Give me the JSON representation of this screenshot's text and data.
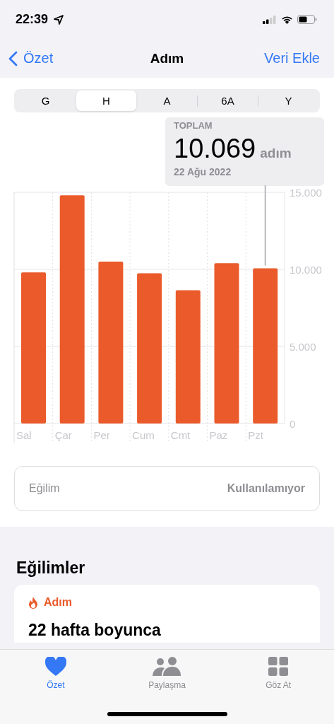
{
  "status_bar": {
    "time": "22:39"
  },
  "nav": {
    "back": "Özet",
    "title": "Adım",
    "action": "Veri Ekle"
  },
  "segments": [
    {
      "label": "G",
      "selected": false
    },
    {
      "label": "H",
      "selected": true
    },
    {
      "label": "A",
      "selected": false
    },
    {
      "label": "6A",
      "selected": false
    },
    {
      "label": "Y",
      "selected": false
    }
  ],
  "callout": {
    "caption": "TOPLAM",
    "value": "10.069",
    "unit": "adım",
    "date": "22 Ağu 2022"
  },
  "chart_data": {
    "type": "bar",
    "categories": [
      "Sal",
      "Çar",
      "Per",
      "Cum",
      "Cmt",
      "Paz",
      "Pzt"
    ],
    "values": [
      9800,
      14800,
      10500,
      9750,
      8650,
      10400,
      10069
    ],
    "ylim": [
      0,
      15000
    ],
    "yticks": [
      {
        "value": 0,
        "label": "0"
      },
      {
        "value": 5000,
        "label": "5.000"
      },
      {
        "value": 10000,
        "label": "10.000"
      },
      {
        "value": 15000,
        "label": "15.000"
      }
    ]
  },
  "trend_row": {
    "label": "Eğilim",
    "value": "Kullanılamıyor"
  },
  "trends": {
    "heading": "Eğilimler",
    "card": {
      "category": "Adım",
      "title": "22 hafta boyunca"
    }
  },
  "tab_bar": [
    {
      "label": "Özet",
      "kind": "heart",
      "selected": true
    },
    {
      "label": "Paylaşma",
      "kind": "people",
      "selected": false
    },
    {
      "label": "Göz At",
      "kind": "grid",
      "selected": false
    }
  ]
}
